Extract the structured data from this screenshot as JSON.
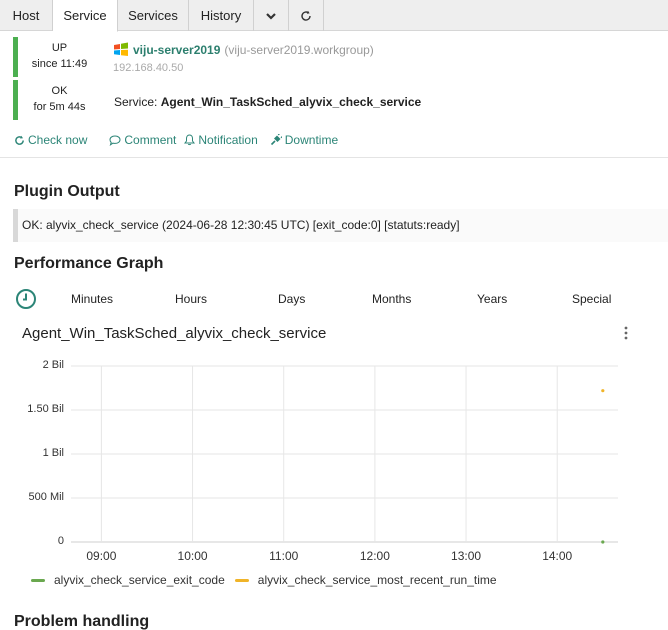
{
  "tabs": [
    {
      "label": "Host",
      "active": false
    },
    {
      "label": "Service",
      "active": true
    },
    {
      "label": "Services",
      "active": false
    },
    {
      "label": "History",
      "active": false
    }
  ],
  "tab_icons": [
    "chevron-down-icon",
    "refresh-icon"
  ],
  "host": {
    "state": "UP",
    "since": "since 11:49",
    "name": "viju-server2019",
    "fqdn": "(viju-server2019.workgroup)",
    "ip": "192.168.40.50"
  },
  "service": {
    "state": "OK",
    "duration": "for 5m 44s",
    "label": "Service:",
    "name": "Agent_Win_TaskSched_alyvix_check_service"
  },
  "actions": {
    "check_now": "Check now",
    "comment": "Comment",
    "notification": "Notification",
    "downtime": "Downtime"
  },
  "plugin_output": {
    "heading": "Plugin Output",
    "text": "OK: alyvix_check_service (2024-06-28 12:30:45 UTC) [exit_code:0] [statuts:ready]"
  },
  "performance": {
    "heading": "Performance Graph",
    "ranges": [
      "Minutes",
      "Hours",
      "Days",
      "Years",
      "Special"
    ],
    "ranges_full": [
      "Minutes",
      "Hours",
      "Days",
      "Months",
      "Years",
      "Special"
    ]
  },
  "colors": {
    "ok": "#4caf50",
    "accent": "#2c8577",
    "series_exit_code": "#6aa84f",
    "series_recent_run": "#f0b429"
  },
  "chart_data": {
    "type": "scatter",
    "title": "Agent_Win_TaskSched_alyvix_check_service",
    "y_ticks": [
      "2 Bil",
      "1.50 Bil",
      "1 Bil",
      "500 Mil",
      "0"
    ],
    "x_ticks": [
      "09:00",
      "10:00",
      "11:00",
      "12:00",
      "13:00",
      "14:00"
    ],
    "ylim": [
      0,
      2000000000
    ],
    "xlim": [
      "08:40",
      "14:40"
    ],
    "grid": true,
    "legend_position": "bottom-left",
    "series": [
      {
        "name": "alyvix_check_service_exit_code",
        "points": [
          {
            "x": "14:30",
            "y": 0
          }
        ]
      },
      {
        "name": "alyvix_check_service_most_recent_run_time",
        "points": [
          {
            "x": "14:30",
            "y": 1719577845
          }
        ]
      }
    ]
  },
  "problem_handling": {
    "heading": "Problem handling"
  }
}
